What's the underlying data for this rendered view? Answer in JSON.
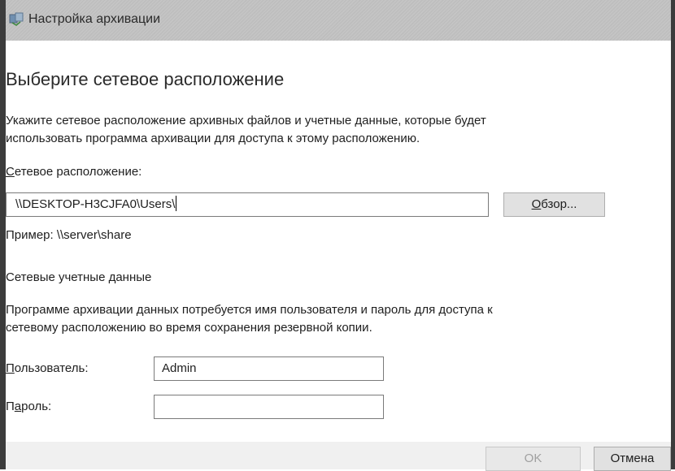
{
  "window": {
    "title": "Настройка архивации",
    "icon": "backup-app-icon"
  },
  "page": {
    "heading": "Выберите сетевое расположение",
    "description_line1": "Укажите сетевое расположение архивных файлов и учетные данные, которые будет",
    "description_line2": "использовать программа архивации для доступа к этому расположению."
  },
  "location": {
    "label_accesskey": "С",
    "label_rest": "етевое расположение:",
    "value": "\\\\DESKTOP-H3CJFA0\\Users\\",
    "browse_accesskey": "О",
    "browse_rest": "бзор...",
    "example": "Пример: \\\\server\\share"
  },
  "credentials": {
    "heading": "Сетевые учетные данные",
    "description_line1": "Программе архивации данных потребуется имя пользователя и пароль для доступа к",
    "description_line2": "сетевому расположению во время сохранения резервной копии.",
    "user_label_accesskey": "П",
    "user_label_rest": "ользователь:",
    "user_value": "Admin",
    "password_label_pre": "П",
    "password_label_accesskey": "а",
    "password_label_rest": "роль:",
    "password_value": ""
  },
  "footer": {
    "ok_label": "OK",
    "ok_enabled": false,
    "cancel_label": "Отмена"
  }
}
